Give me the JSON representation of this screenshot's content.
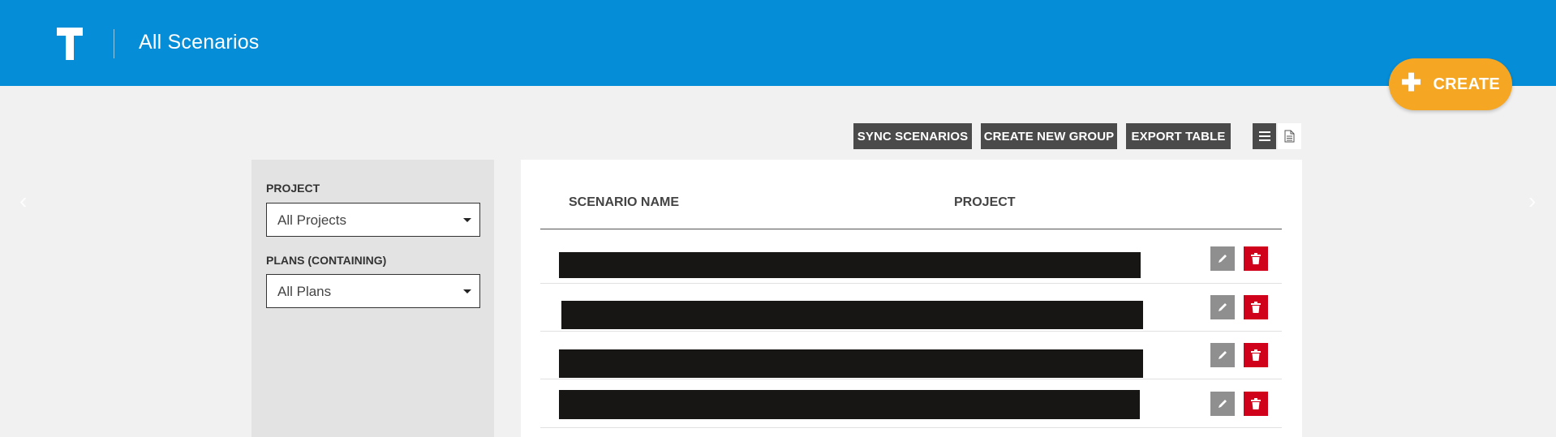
{
  "header": {
    "logo_letter": "T",
    "title": "All Scenarios",
    "create_label": "CREATE",
    "background_color": "#058dd8",
    "create_color": "#f5a623"
  },
  "toolbar": {
    "sync_label": "SYNC SCENARIOS",
    "new_group_label": "CREATE NEW GROUP",
    "export_label": "EXPORT TABLE",
    "list_view_icon": "list-icon",
    "doc_view_icon": "document-icon"
  },
  "filters": {
    "project": {
      "label": "PROJECT",
      "value": "All Projects"
    },
    "plans": {
      "label": "PLANS (CONTAINING)",
      "value": "All Plans"
    }
  },
  "table": {
    "columns": [
      "SCENARIO NAME",
      "PROJECT"
    ],
    "rows": [
      {
        "name": "[redacted]",
        "edit_icon": "pencil-icon",
        "delete_icon": "trash-icon"
      },
      {
        "name": "[redacted]",
        "edit_icon": "pencil-icon",
        "delete_icon": "trash-icon"
      },
      {
        "name": "[redacted]",
        "edit_icon": "pencil-icon",
        "delete_icon": "trash-icon"
      },
      {
        "name": "[redacted]",
        "edit_icon": "pencil-icon",
        "delete_icon": "trash-icon"
      }
    ],
    "delete_color": "#d0021b"
  },
  "carousel": {
    "prev_icon": "chevron-left-icon",
    "next_icon": "chevron-right-icon"
  }
}
